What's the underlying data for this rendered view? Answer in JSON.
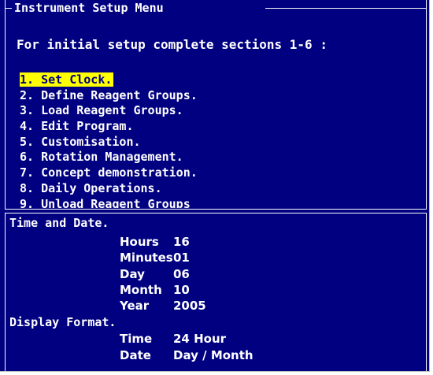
{
  "window": {
    "title": "Instrument Setup Menu",
    "background_color": "#000080",
    "text_color": "#ffffff",
    "highlight_color": "#ffff00"
  },
  "menu": {
    "intro": "For initial setup complete sections 1-6 :",
    "selected_index": 0,
    "items": [
      {
        "label": "1. Set Clock."
      },
      {
        "label": "2. Define Reagent Groups."
      },
      {
        "label": "3. Load Reagent Groups."
      },
      {
        "label": "4. Edit Program."
      },
      {
        "label": "5. Customisation."
      },
      {
        "label": "6. Rotation Management."
      },
      {
        "label": "7. Concept demonstration."
      },
      {
        "label": "8. Daily Operations."
      },
      {
        "label": "9. Unload Reagent Groups"
      }
    ]
  },
  "details": {
    "time_date": {
      "heading": "Time and Date.",
      "hours_label": "Hours",
      "hours_value": "16",
      "minutes_label": "Minutes",
      "minutes_value": "01",
      "day_label": "Day",
      "day_value": "06",
      "month_label": "Month",
      "month_value": "10",
      "year_label": "Year",
      "year_value": "2005"
    },
    "display_format": {
      "heading": "Display Format.",
      "time_label": "Time",
      "time_value": "24 Hour",
      "date_label": "Date",
      "date_value": "Day / Month"
    }
  }
}
